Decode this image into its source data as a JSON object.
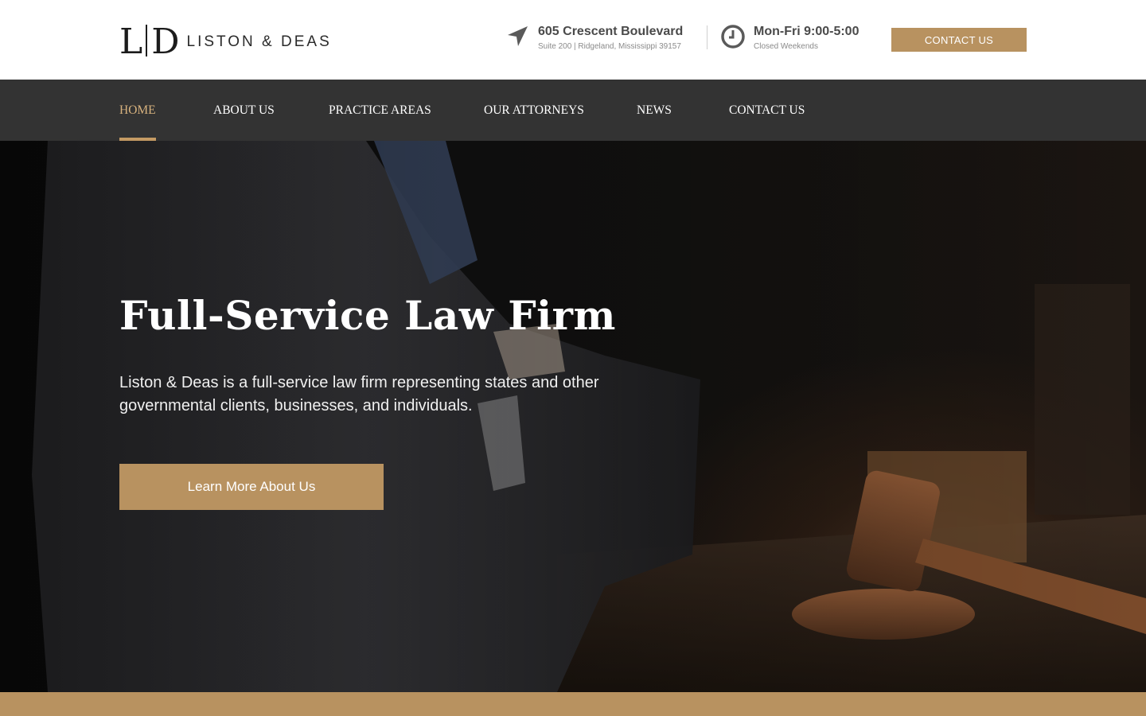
{
  "brand": {
    "monogram_left": "L",
    "monogram_right": "D",
    "name": "LISTON & DEAS"
  },
  "header": {
    "address": {
      "icon": "location-arrow-icon",
      "title": "605 Crescent Boulevard",
      "subtitle": "Suite 200 | Ridgeland, Mississippi 39157"
    },
    "hours": {
      "icon": "clock-icon",
      "title": "Mon-Fri 9:00-5:00",
      "subtitle": "Closed Weekends"
    },
    "cta_label": "CONTACT US"
  },
  "nav": {
    "items": [
      {
        "label": "HOME",
        "active": true
      },
      {
        "label": "ABOUT US",
        "active": false
      },
      {
        "label": "PRACTICE AREAS",
        "active": false
      },
      {
        "label": "OUR ATTORNEYS",
        "active": false
      },
      {
        "label": "NEWS",
        "active": false
      },
      {
        "label": "CONTACT US",
        "active": false
      }
    ]
  },
  "hero": {
    "title": "Full-Service Law Firm",
    "description": "Liston & Deas is a full-service law firm representing states and other governmental clients, businesses, and individuals.",
    "button_label": "Learn More About Us"
  },
  "colors": {
    "accent": "#b89260",
    "nav_background": "#333333",
    "active_nav": "#d7b27e"
  }
}
